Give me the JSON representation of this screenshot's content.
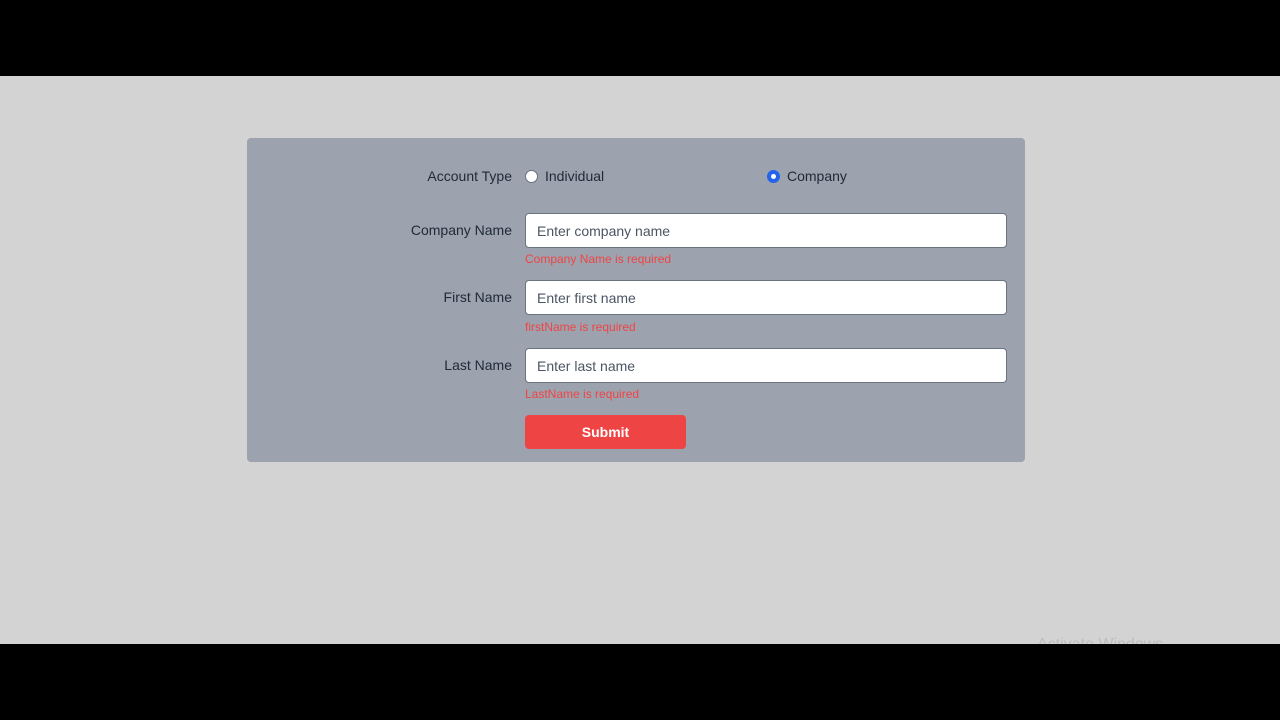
{
  "form": {
    "account_type": {
      "label": "Account Type",
      "options": [
        {
          "label": "Individual",
          "checked": false
        },
        {
          "label": "Company",
          "checked": true
        }
      ]
    },
    "company_name": {
      "label": "Company Name",
      "placeholder": "Enter company name",
      "value": "",
      "error": "Company Name is required"
    },
    "first_name": {
      "label": "First Name",
      "placeholder": "Enter first name",
      "value": "",
      "error": "firstName is required"
    },
    "last_name": {
      "label": "Last Name",
      "placeholder": "Enter last name",
      "value": "",
      "error": "LastName is required"
    },
    "submit_label": "Submit"
  },
  "overlay": {
    "watermark": "Activate Windows"
  },
  "colors": {
    "page_background": "#d3d3d3",
    "card_background": "#9ca3af",
    "error": "#ef4444",
    "submit_button": "#ef4444",
    "radio_accent": "#2563eb"
  }
}
